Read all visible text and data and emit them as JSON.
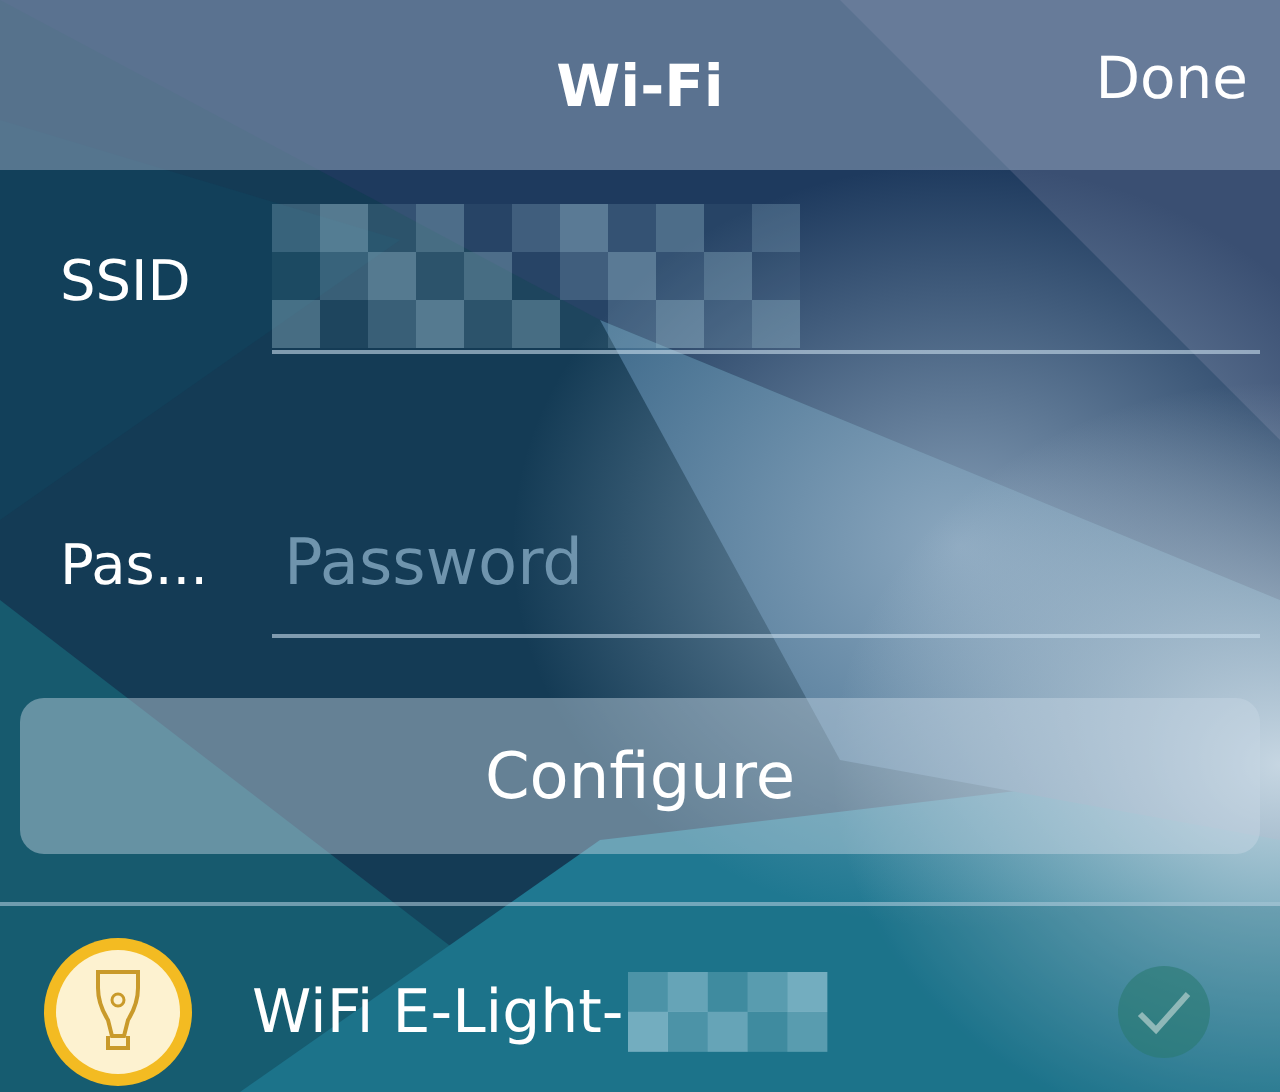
{
  "nav": {
    "title": "Wi-Fi",
    "done": "Done"
  },
  "fields": [
    {
      "label": "SSID",
      "redacted": true
    },
    {
      "label": "Pas...",
      "placeholder": "Password"
    }
  ],
  "configure_button": "Configure",
  "devices": [
    {
      "name": "WiFi E-Light-",
      "redacted": true,
      "selected": false
    }
  ]
}
